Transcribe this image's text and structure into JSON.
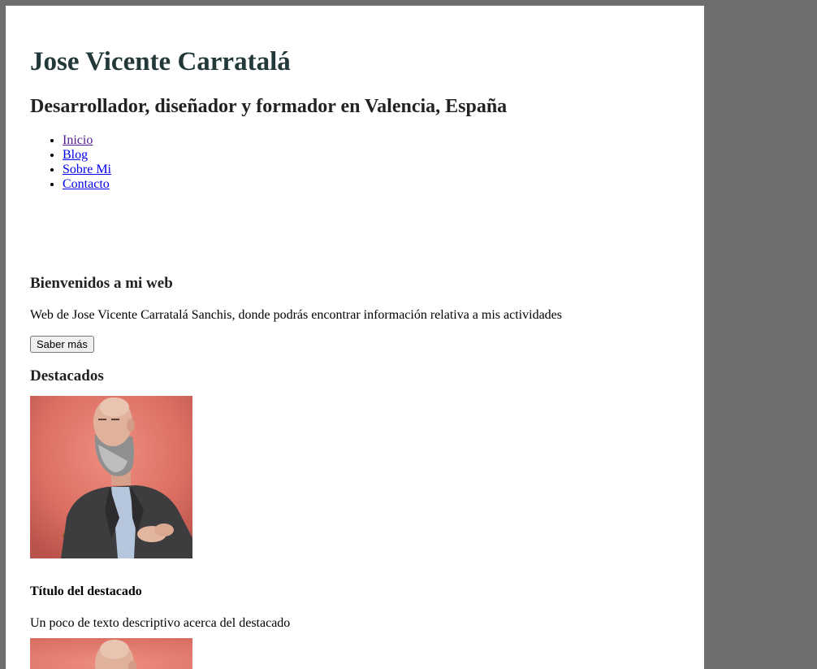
{
  "header": {
    "title": "Jose Vicente Carratalá",
    "subtitle": "Desarrollador, diseñador y formador en Valencia, España"
  },
  "nav": {
    "items": [
      {
        "label": "Inicio"
      },
      {
        "label": "Blog"
      },
      {
        "label": "Sobre Mi"
      },
      {
        "label": "Contacto"
      }
    ]
  },
  "welcome": {
    "heading": "Bienvenidos a mi web",
    "text": "Web de Jose Vicente Carratalá Sanchis, donde podrás encontrar información relativa a mis actividades",
    "button_label": "Saber más"
  },
  "featured": {
    "heading": "Destacados",
    "items": [
      {
        "title": "Título del destacado",
        "text": "Un poco de texto descriptivo acerca del destacado"
      }
    ]
  },
  "colors": {
    "page_background": "#ffffff",
    "outer_background": "#6e6e6e",
    "title_color": "#233838",
    "link_color": "#0000ee",
    "visited_link_color": "#551a8b"
  }
}
